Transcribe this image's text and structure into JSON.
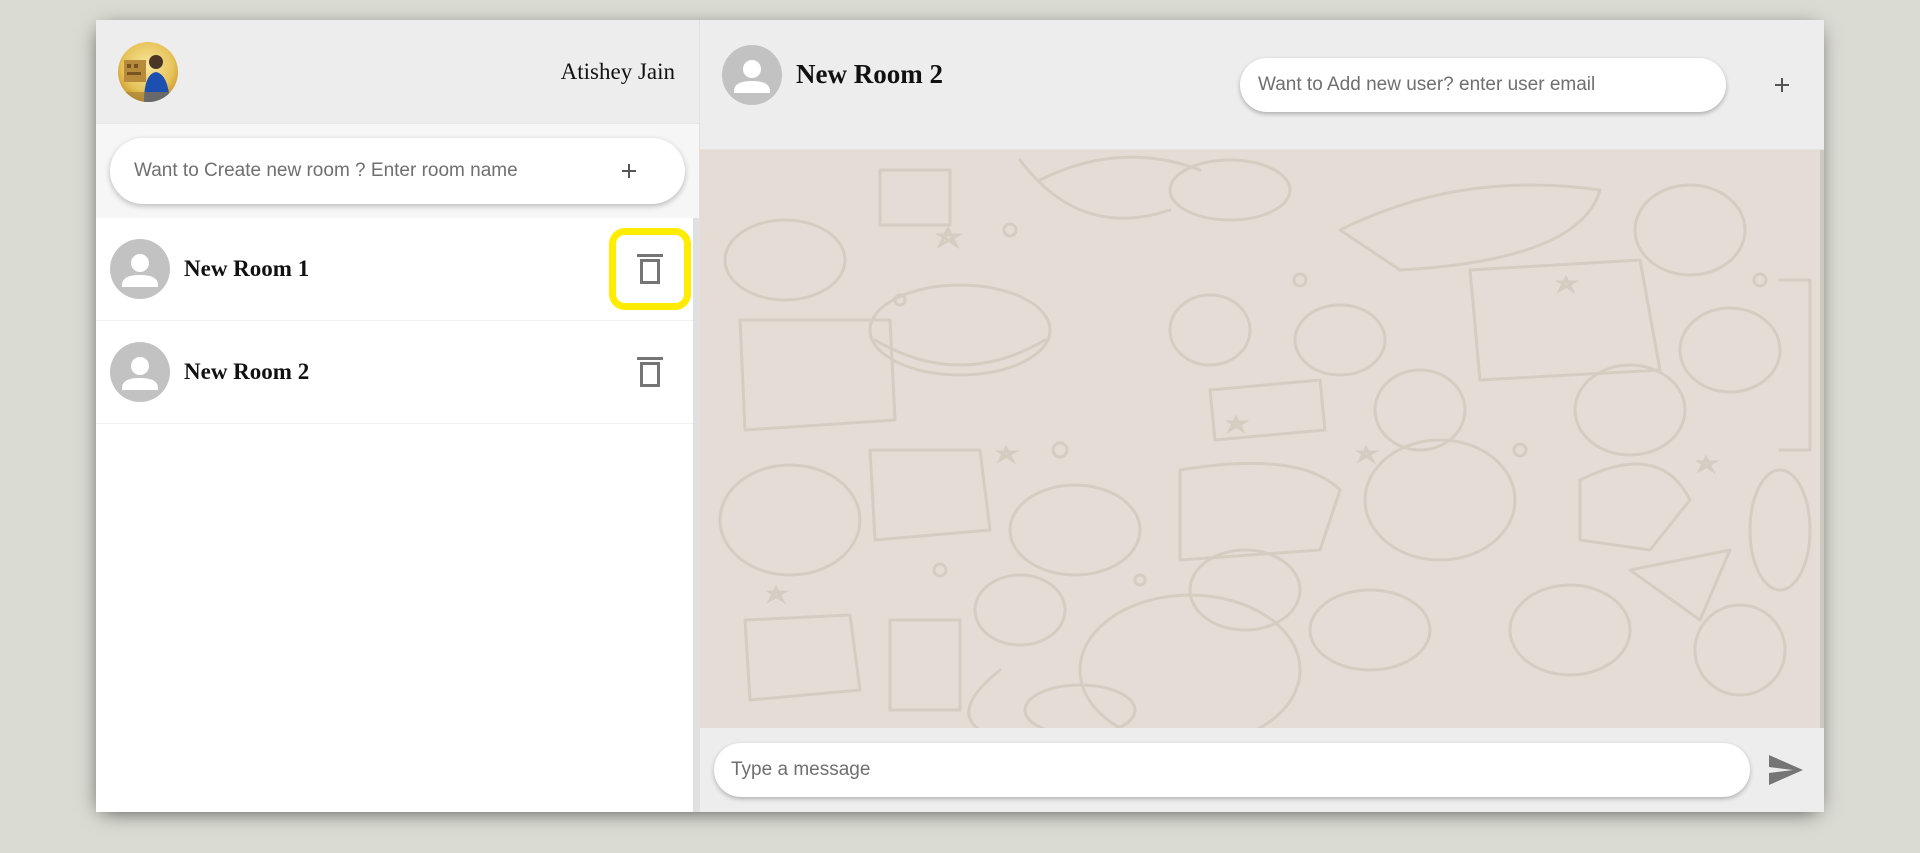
{
  "colors": {
    "page_background": "#dadbd3",
    "panel_background": "#ededed",
    "chat_wallpaper": "#e5ddd5",
    "highlight": "#ffec00",
    "avatar_placeholder": "#c2c2c2",
    "icon_gray": "#757575"
  },
  "sidebar": {
    "user_avatar_icon": "user-profile-photo",
    "user_name": "Atishey Jain",
    "create_room_placeholder": "Want to Create new room ? Enter room name",
    "create_room_icon": "plus-icon",
    "rooms": [
      {
        "name": "New Room 1",
        "avatar_icon": "person-icon",
        "action_icon": "trash-icon",
        "highlighted": true
      },
      {
        "name": "New Room 2",
        "avatar_icon": "person-icon",
        "action_icon": "trash-icon",
        "highlighted": false
      }
    ]
  },
  "chat": {
    "room_name": "New Room 2",
    "room_avatar_icon": "person-icon",
    "add_user_placeholder": "Want to Add new user? enter user email",
    "add_user_icon": "plus-icon",
    "message_placeholder": "Type a message",
    "send_icon": "send-icon"
  }
}
